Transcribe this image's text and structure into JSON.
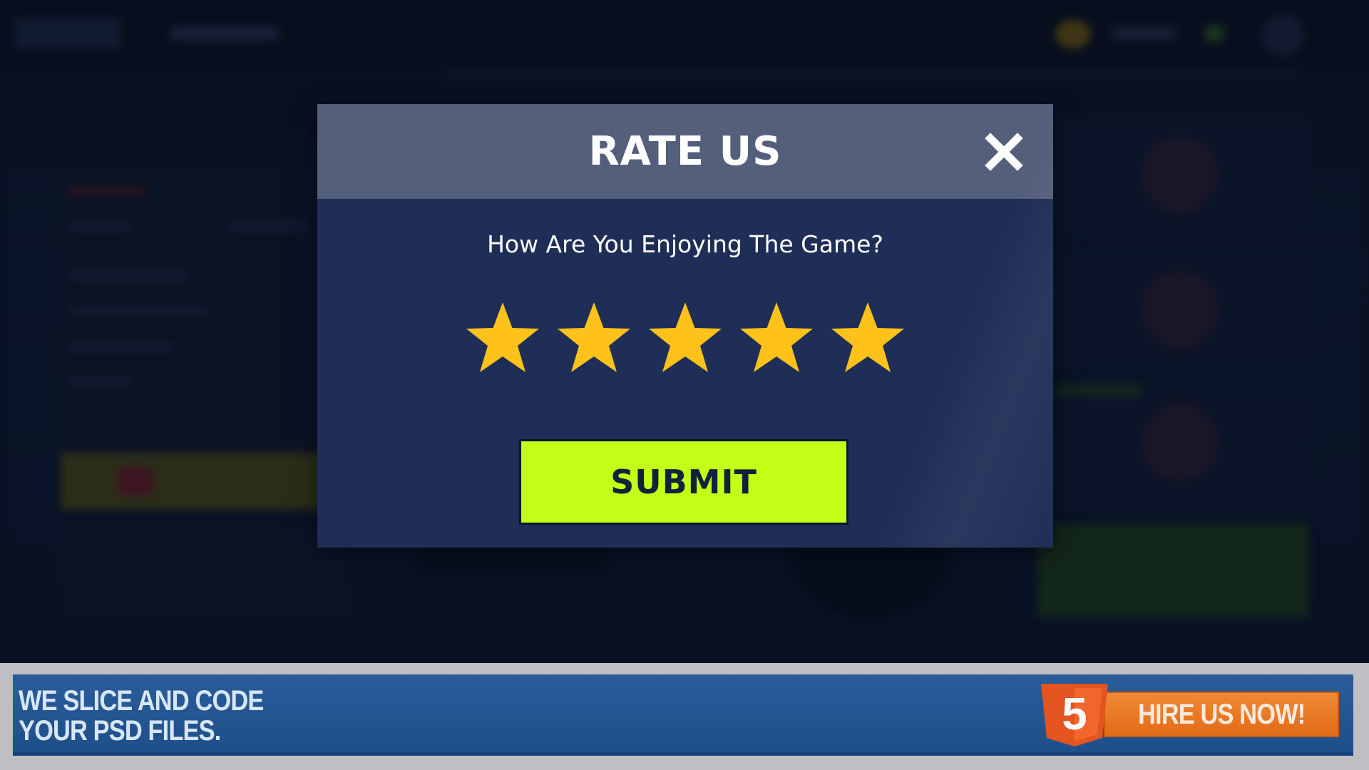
{
  "modal": {
    "title": "RATE US",
    "question": "How Are You Enjoying The Game?",
    "rating": 5,
    "max_rating": 5,
    "star_color": "#ffc21a",
    "submit_label": "SUBMIT",
    "submit_color": "#c3ff17",
    "close_icon": "close-icon"
  },
  "ad": {
    "headline_line1": "WE SLICE AND CODE",
    "headline_line2": "YOUR PSD FILES.",
    "icon": "html5-icon",
    "icon_text": "5",
    "button_label": "HIRE US NOW!",
    "button_color": "#e8741f"
  }
}
